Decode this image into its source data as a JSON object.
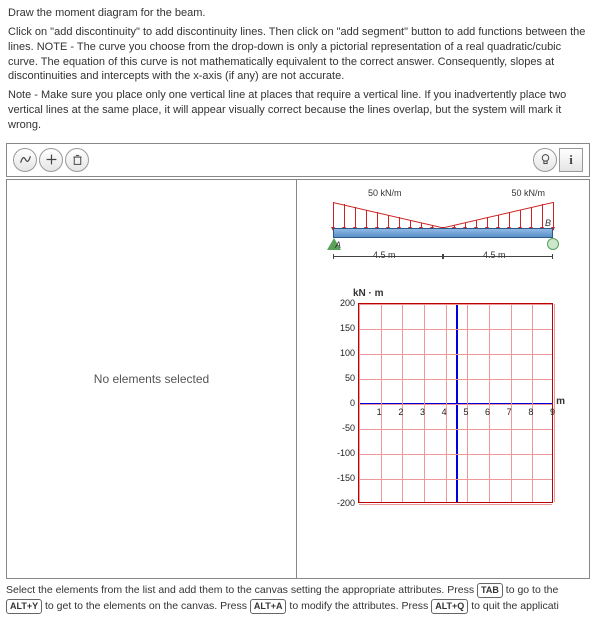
{
  "instructions": {
    "title": "Draw the moment diagram for the beam.",
    "p1": "Click on \"add discontinuity\" to add discontinuity lines. Then click on \"add segment\" button to add functions between the lines. NOTE - The curve you choose from the drop-down is only a pictorial representation of a real quadratic/cubic curve. The equation of this curve is not mathematically equivalent to the correct answer. Consequently, slopes at discontinuities and intercepts with the x-axis (if any) are not accurate.",
    "p2": "Note - Make sure you place only one vertical line at places that require a vertical line. If you inadvertently place two vertical lines at the same place, it will appear visually correct because the lines overlap, but the system will mark it wrong."
  },
  "left_panel": {
    "message": "No elements selected"
  },
  "beam": {
    "load_left_label": "50 kN/m",
    "load_right_label": "50 kN/m",
    "pointA": "A",
    "pointB": "B",
    "dim_left": "4.5 m",
    "dim_right": "4.5 m"
  },
  "chart_data": {
    "type": "line",
    "title": "",
    "xlabel": "m",
    "ylabel": "kN · m",
    "xlim": [
      0,
      9
    ],
    "ylim": [
      -200,
      200
    ],
    "xticks": [
      0,
      1,
      2,
      3,
      4,
      5,
      6,
      7,
      8,
      9
    ],
    "yticks": [
      -200,
      -150,
      -100,
      -50,
      0,
      50,
      100,
      150,
      200
    ],
    "series": []
  },
  "footer": {
    "text1a": "Select the elements from the list and add them to the canvas setting the appropriate attributes. Press ",
    "kbd1": "TAB",
    "text1b": " to go to the",
    "kbd2": "ALT+Y",
    "text2a": " to get to the elements on the canvas. Press ",
    "kbd3": "ALT+A",
    "text2b": " to modify the attributes. Press ",
    "kbd4": "ALT+Q",
    "text2c": " to quit the applicati"
  }
}
